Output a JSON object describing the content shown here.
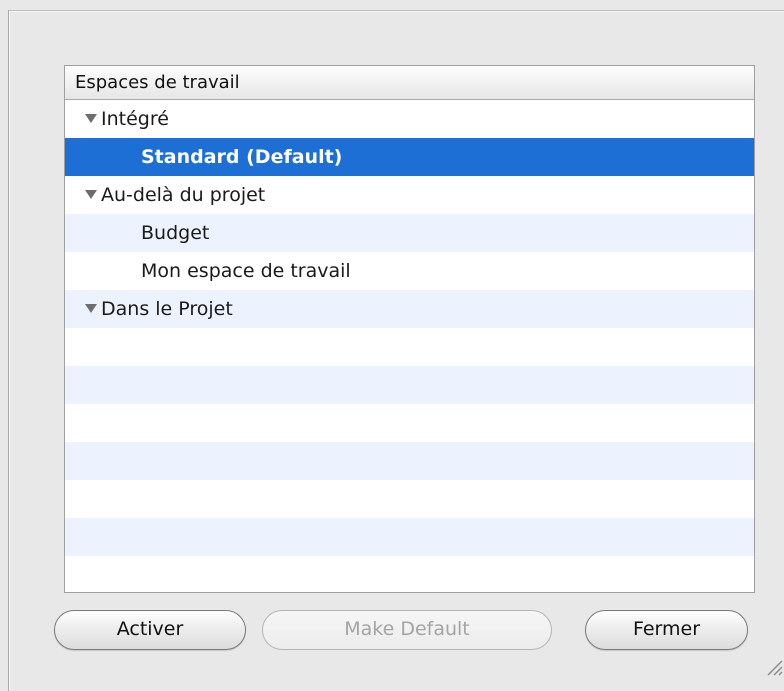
{
  "dialog": {
    "table": {
      "header": "Espaces de travail",
      "rows": [
        {
          "kind": "group",
          "label": "Intégré"
        },
        {
          "kind": "child",
          "label": "Standard (Default)",
          "selected": true
        },
        {
          "kind": "group",
          "label": "Au-delà du projet"
        },
        {
          "kind": "child",
          "label": "Budget"
        },
        {
          "kind": "child",
          "label": "Mon espace de travail"
        },
        {
          "kind": "group",
          "label": "Dans le Projet"
        }
      ],
      "empty_rows": 7
    },
    "buttons": {
      "activate": "Activer",
      "make_default": "Make Default",
      "close": "Fermer"
    }
  },
  "colors": {
    "selection": "#1d6fd6",
    "alternate_row": "#edf3fe",
    "window_bg": "#e8e8e8"
  },
  "icons": {
    "disclosure": "disclosure-triangle-down-icon",
    "resize": "resize-grip-icon"
  }
}
